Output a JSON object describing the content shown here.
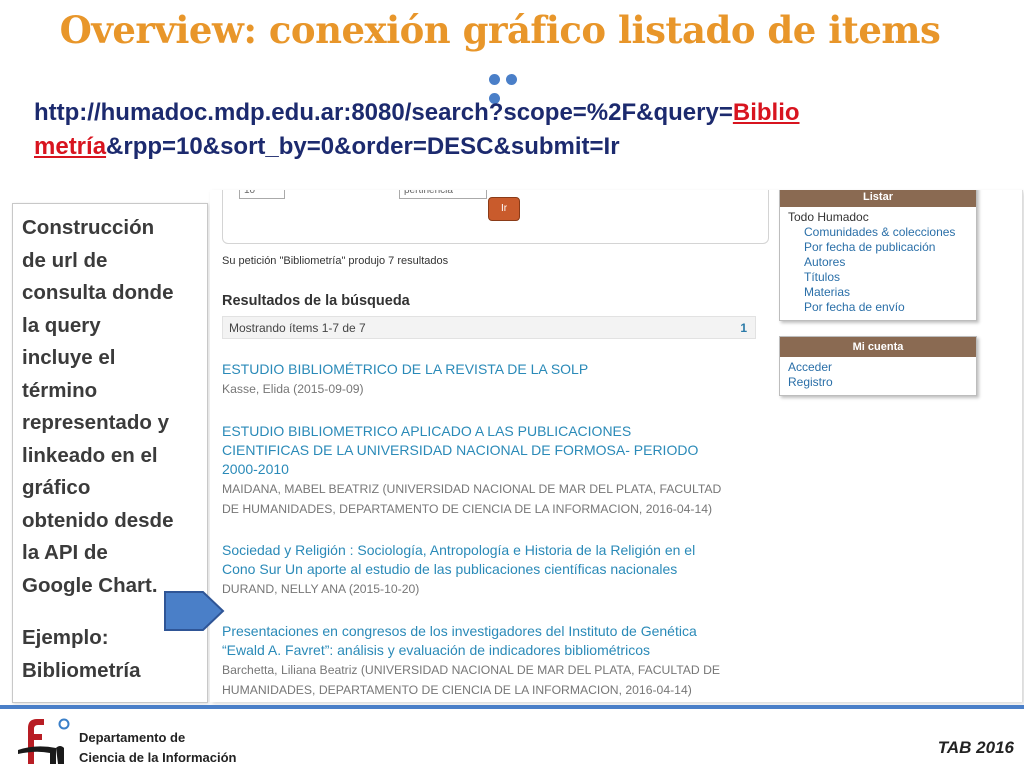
{
  "slide": {
    "title": "Overview: conexión gráfico listado de items",
    "url_part1": "http://humadoc.mdp.edu.ar:8080/search?scope=%2F&query=",
    "url_link1": "Biblio",
    "url_link2": "metría",
    "url_part2": "&rpp=10&sort_by=0&order=DESC&submit=Ir",
    "description": [
      "Construcción",
      "de url de",
      "consulta donde",
      "la query",
      "incluye el",
      "término",
      "representado y",
      "linkeado en el",
      "gráfico",
      "obtenido desde",
      "la API de",
      "Google Chart."
    ],
    "example_label": "Ejemplo:",
    "example_value": "Bibliometría",
    "accent_color": "#e8962a",
    "link_color": "#d8141f"
  },
  "screenshot": {
    "rpp_value": "10",
    "sort_value": "pertinencia",
    "go_button": "Ir",
    "request_text": "Su petición \"Bibliometría\" produjo 7 resultados",
    "results_heading": "Resultados de la búsqueda",
    "showing": "Mostrando ítems 1-7 de 7",
    "page_number": "1",
    "items": [
      {
        "title": [
          "ESTUDIO BIBLIOMÉTRICO DE LA REVISTA DE LA SOLP"
        ],
        "authors": [
          "Kasse, Elida (2015-09-09)"
        ]
      },
      {
        "title": [
          "ESTUDIO BIBLIOMETRICO APLICADO A LAS PUBLICACIONES",
          "CIENTIFICAS DE LA UNIVERSIDAD NACIONAL DE FORMOSA- PERIODO",
          "2000-2010"
        ],
        "authors": [
          "MAIDANA, MABEL BEATRIZ (UNIVERSIDAD NACIONAL DE MAR DEL PLATA, FACULTAD",
          "DE HUMANIDADES, DEPARTAMENTO DE CIENCIA DE LA INFORMACION, 2016-04-14)"
        ]
      },
      {
        "title": [
          "Sociedad y Religión : Sociología, Antropología e Historia de la Religión en el",
          "Cono Sur Un aporte al estudio de las publicaciones científicas nacionales"
        ],
        "authors": [
          "DURAND, NELLY ANA (2015-10-20)"
        ]
      },
      {
        "title": [
          "Presentaciones en congresos de los investigadores del Instituto de Genética",
          "“Ewald A. Favret”: análisis y evaluación de indicadores bibliométricos"
        ],
        "authors": [
          "Barchetta, Liliana Beatriz (UNIVERSIDAD NACIONAL DE MAR DEL PLATA, FACULTAD DE",
          "HUMANIDADES, DEPARTAMENTO DE CIENCIA DE LA INFORMACION, 2016-04-14)"
        ]
      }
    ],
    "listar": {
      "header": "Listar",
      "root": "Todo Humadoc",
      "links": [
        "Comunidades & colecciones",
        "Por fecha de publicación",
        "Autores",
        "Títulos",
        "Materias",
        "Por fecha de envío"
      ]
    },
    "cuenta": {
      "header": "Mi cuenta",
      "links": [
        "Acceder",
        "Registro"
      ]
    }
  },
  "footer": {
    "dept_line1": "Departamento de",
    "dept_line2": "Ciencia de la Información",
    "tab_label": "TAB 2016",
    "line_color": "#4a7fc8"
  }
}
